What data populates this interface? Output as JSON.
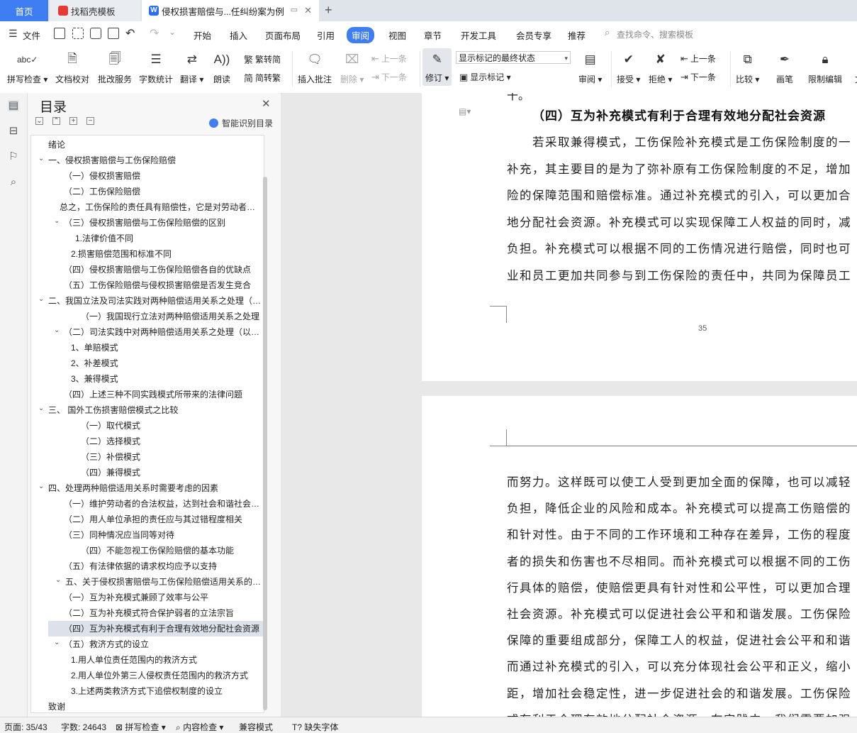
{
  "tabs": {
    "home": "首页",
    "template": "找稻壳模板",
    "document": "侵权损害赔偿与...任纠纷案为例"
  },
  "menu": {
    "file": "文件",
    "items": [
      "开始",
      "插入",
      "页面布局",
      "引用",
      "审阅",
      "视图",
      "章节",
      "开发工具",
      "会员专享",
      "推荐"
    ],
    "active": "审阅",
    "search_placeholder": "查找命令、搜索模板"
  },
  "ribbon": {
    "spellcheck": "拼写检查",
    "doc_proof": "文档校对",
    "batch_service": "批改服务",
    "word_count": "字数统计",
    "translate": "翻译",
    "read_aloud": "朗读",
    "trad_to_simp": "繁转简",
    "simp_to_trad": "简转繁",
    "insert_comment": "插入批注",
    "delete": "删除",
    "prev_comment": "上一条",
    "next_comment": "下一条",
    "revise": "修订",
    "markup_state": "显示标记的最终状态",
    "show_markup": "显示标记",
    "review": "审阅",
    "accept": "接受",
    "reject": "拒绝",
    "prev_change": "上一条",
    "next_change": "下一条",
    "compare": "比较",
    "pen": "画笔",
    "restrict_edit": "限制编辑",
    "more": "文"
  },
  "toc": {
    "title": "目录",
    "smart_label": "智能识别目录",
    "items": [
      {
        "text": "绪论",
        "indent": 24,
        "chev": false
      },
      {
        "text": "一、侵权损害赔偿与工伤保险赔偿",
        "indent": 24,
        "chev": true
      },
      {
        "text": "（一）侵权损害赔偿",
        "indent": 46,
        "chev": false
      },
      {
        "text": "（二）工伤保险赔偿",
        "indent": 46,
        "chev": false
      },
      {
        "text": "总之，工伤保险的责任具有赔偿性，它是对劳动者因工作原因而遭受的伤害所给予的补偿",
        "indent": 40,
        "chev": false
      },
      {
        "text": "（三）侵权损害赔偿与工伤保险赔偿的区别",
        "indent": 46,
        "chev": true
      },
      {
        "text": "1.法律价值不同",
        "indent": 62,
        "chev": false
      },
      {
        "text": "2.损害赔偿范围和标准不同",
        "indent": 56,
        "chev": false
      },
      {
        "text": "（四）侵权损害赔偿与工伤保险赔偿各自的优缺点",
        "indent": 46,
        "chev": false
      },
      {
        "text": "（五）工伤保险赔偿与侵权损害赔偿是否发生竞合",
        "indent": 46,
        "chev": false
      },
      {
        "text": "二、我国立法及司法实践对两种赔偿适用关系之处理（以浙江省为例）",
        "indent": 24,
        "chev": true
      },
      {
        "text": "（一）我国现行立法对两种赔偿适用关系之处理",
        "indent": 70,
        "chev": false
      },
      {
        "text": "（二）司法实践中对两种赔偿适用关系之处理（以浙江省为例）",
        "indent": 46,
        "chev": true
      },
      {
        "text": "1、单赔模式",
        "indent": 56,
        "chev": false
      },
      {
        "text": "2、补差模式",
        "indent": 56,
        "chev": false
      },
      {
        "text": "3、兼得模式",
        "indent": 56,
        "chev": false
      },
      {
        "text": "（四）上述三种不同实践模式所带来的法律问题",
        "indent": 46,
        "chev": false
      },
      {
        "text": "三、 国外工伤损害赔偿模式之比较",
        "indent": 24,
        "chev": true
      },
      {
        "text": "（一）取代模式",
        "indent": 70,
        "chev": false
      },
      {
        "text": "（二）选择模式",
        "indent": 70,
        "chev": false
      },
      {
        "text": "（三）补偿模式",
        "indent": 70,
        "chev": false
      },
      {
        "text": "（四）兼得模式",
        "indent": 70,
        "chev": false
      },
      {
        "text": "四、处理两种赔偿适用关系时需要考虑的因素",
        "indent": 24,
        "chev": true
      },
      {
        "text": "（一）维护劳动者的合法权益，达到社会和谐社会稳定",
        "indent": 46,
        "chev": false
      },
      {
        "text": "（二）用人单位承担的责任应与其过错程度相关",
        "indent": 46,
        "chev": false
      },
      {
        "text": "（三）同种情况应当同等对待",
        "indent": 46,
        "chev": false
      },
      {
        "text": "（四）不能忽视工伤保险赔偿的基本功能",
        "indent": 70,
        "chev": false
      },
      {
        "text": "（五）有法律依据的请求权均应予以支持",
        "indent": 46,
        "chev": false
      },
      {
        "text": "五、关于侵权损害赔偿与工伤保险赔偿适用关系的建议",
        "indent": 48,
        "chev": true
      },
      {
        "text": "（一）互为补充模式兼顾了效率与公平",
        "indent": 46,
        "chev": false
      },
      {
        "text": "（二）互为补充模式符合保护弱者的立法宗旨",
        "indent": 46,
        "chev": false
      },
      {
        "text": "（四）互为补充模式有利于合理有效地分配社会资源",
        "indent": 46,
        "chev": false,
        "selected": true
      },
      {
        "text": "（五）救济方式的设立",
        "indent": 46,
        "chev": true
      },
      {
        "text": "1.用人单位责任范围内的救济方式",
        "indent": 56,
        "chev": false
      },
      {
        "text": "2.用人单位外第三人侵权责任范围内的救济方式",
        "indent": 56,
        "chev": false
      },
      {
        "text": "3.上述两类救济方式下追偿权制度的设立",
        "indent": 56,
        "chev": false
      },
      {
        "text": "致谢",
        "indent": 24,
        "chev": false
      }
    ]
  },
  "document": {
    "page1_top_fragment": "干。",
    "heading": "（四）互为补充模式有利于合理有效地分配社会资源",
    "page1_lines": [
      "若采取兼得模式，工伤保险补充模式是工伤保险制度的一",
      "补充，其主要目的是为了弥补原有工伤保险制度的不足，增加",
      "险的保障范围和赔偿标准。通过补充模式的引入，可以更加合",
      "地分配社会资源。补充模式可以实现保障工人权益的同时，减",
      "负担。补充模式可以根据不同的工伤情况进行赔偿，同时也可",
      "业和员工更加共同参与到工伤保险的责任中，共同为保障员工"
    ],
    "page_number": "35",
    "page2_lines": [
      "而努力。这样既可以使工人受到更加全面的保障，也可以减轻",
      "负担，降低企业的风险和成本。补充模式可以提高工伤赔偿的",
      "和针对性。由于不同的工作环境和工种存在差异，工伤的程度",
      "者的损失和伤害也不尽相同。而补充模式可以根据不同的工伤",
      "行具体的赔偿，使赔偿更具有针对性和公平性，可以更加合理",
      "社会资源。补充模式可以促进社会公平和和谐发展。工伤保险",
      "保障的重要组成部分，保障工人的权益，促进社会公平和和谐",
      "而通过补充模式的引入，可以充分体现社会公平和正义，缩小",
      "距，增加社会稳定性，进一步促进社会的和谐发展。工伤保险",
      "式有利于合理有效地分配社会资源。在实践中，我们需要加强"
    ]
  },
  "status": {
    "page": "页面: 35/43",
    "words": "字数: 24643",
    "spellcheck": "拼写检查",
    "content_check": "内容检查",
    "compat": "兼容模式",
    "missing_font": "缺失字体"
  }
}
